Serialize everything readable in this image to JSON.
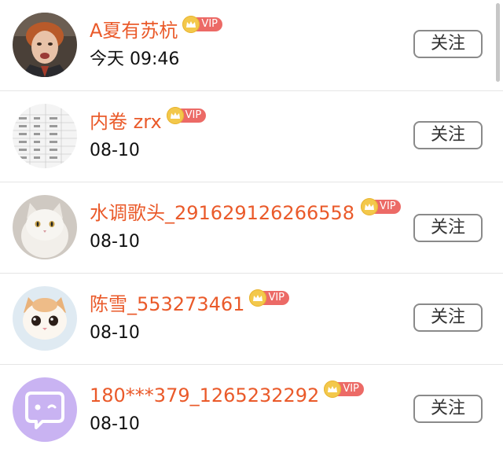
{
  "follow_label": "关注",
  "vip_label": "VIP",
  "users": [
    {
      "name": "A夏有苏杭",
      "time": "今天 09:46",
      "avatar": "boy-photo"
    },
    {
      "name": "内卷 zrx",
      "time": "08-10",
      "avatar": "spreadsheet-photo"
    },
    {
      "name": "水调歌头_291629126266558",
      "time": "08-10",
      "avatar": "white-cat-photo"
    },
    {
      "name": "陈雪_553273461",
      "time": "08-10",
      "avatar": "kitten-photo"
    },
    {
      "name": "180***379_1265232292",
      "time": "08-10",
      "avatar": "default-chat-avatar"
    }
  ],
  "colors": {
    "name": "#ea5a2a",
    "vip_tag": "#ec6a66",
    "crown": "#f3c84b",
    "default_avatar": "#c9b3f2"
  }
}
